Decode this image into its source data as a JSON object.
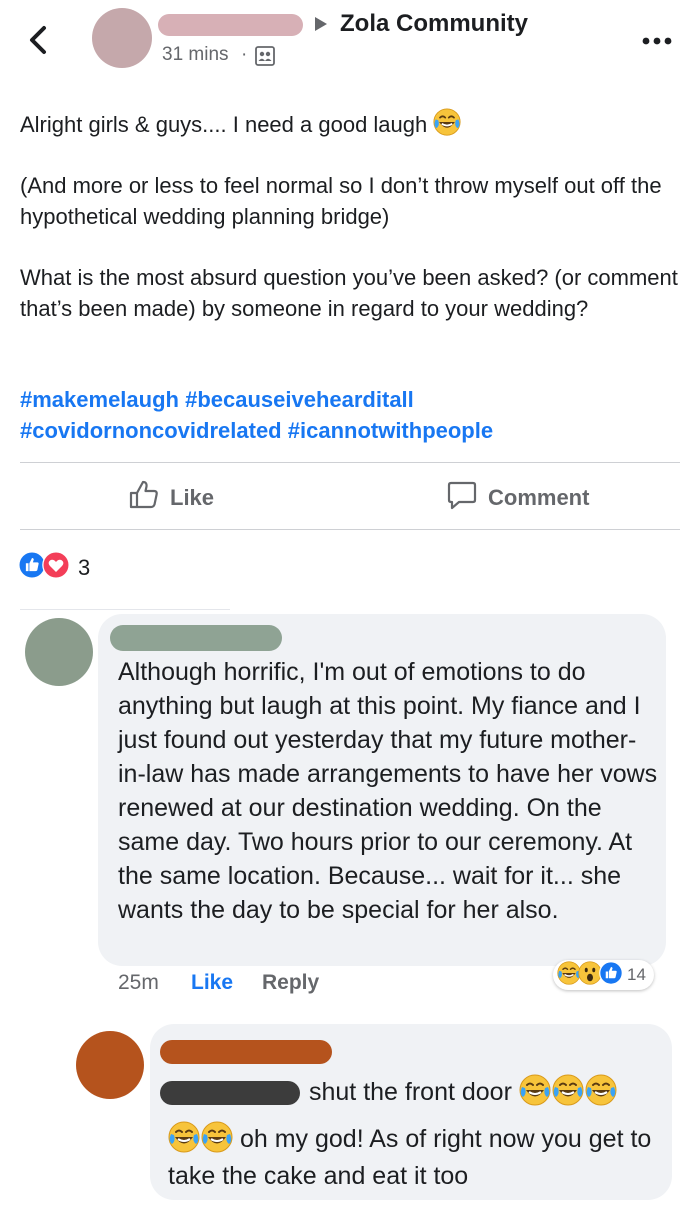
{
  "header": {
    "group_name": "Zola Community",
    "time": "31 mins",
    "separator": "·",
    "icons": {
      "back": "chevron-left-icon",
      "privacy": "group-members-icon",
      "more": "more-horizontal-icon"
    }
  },
  "post": {
    "line1": "Alright girls & guys.... I need a good laugh",
    "line1_emoji": "laughing-tears-emoji",
    "paragraph2": "(And more or less to feel normal so I don’t throw myself out off the hypothetical wedding planning bridge)",
    "paragraph3": "What is the most absurd question you’ve been asked? (or comment that’s been made)  by someone in regard to your wedding?",
    "hashtags": [
      "#makemelaugh",
      "#becauseivehearditall",
      "#covidornoncovidrelated",
      "#icannotwithpeople"
    ]
  },
  "actions": {
    "like_label": "Like",
    "comment_label": "Comment"
  },
  "reactions": {
    "types": [
      "like",
      "love"
    ],
    "count": "3"
  },
  "comments": [
    {
      "text": "Although horrific, I'm out of emotions to do anything but laugh at this point. My fiance and I just found out yesterday that my future mother-in-law has made arrangements to have her vows renewed at our destination wedding. On the same day. Two hours prior to our ceremony. At the same location. Because... wait for it... she wants the day to be special for her also.",
      "time": "25m",
      "like_label": "Like",
      "reply_label": "Reply",
      "reaction_types": [
        "haha",
        "wow",
        "like"
      ],
      "reaction_count": "14"
    },
    {
      "text_part1": "shut the front door",
      "text_part2": "oh my god! As of right now you get to take the cake and eat it too"
    }
  ],
  "colors": {
    "link_blue": "#1877f2",
    "secondary_text": "#65676b",
    "bubble_bg": "#f0f2f5",
    "love_red": "#f33e58"
  }
}
